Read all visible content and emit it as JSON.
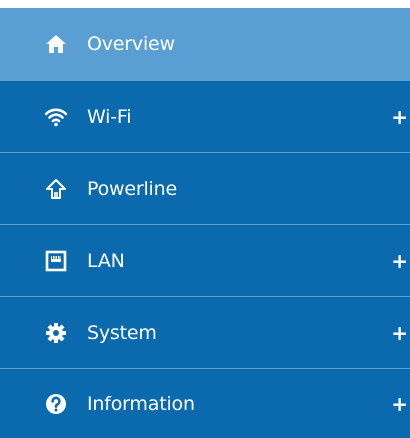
{
  "menu": {
    "items": [
      {
        "label": "Overview",
        "icon": "home-icon",
        "active": true,
        "expand": ""
      },
      {
        "label": "Wi-Fi",
        "icon": "wifi-icon",
        "active": false,
        "expand": "+"
      },
      {
        "label": "Powerline",
        "icon": "powerline-icon",
        "active": false,
        "expand": ""
      },
      {
        "label": "LAN",
        "icon": "lan-port-icon",
        "active": false,
        "expand": "+"
      },
      {
        "label": "System",
        "icon": "gear-icon",
        "active": false,
        "expand": "+"
      },
      {
        "label": "Information",
        "icon": "question-icon",
        "active": false,
        "expand": "+"
      }
    ]
  },
  "colors": {
    "item_background": "#0a6aad",
    "active_background": "#5a9fd3",
    "divider": "#5d9fcd",
    "text": "#ffffff"
  }
}
